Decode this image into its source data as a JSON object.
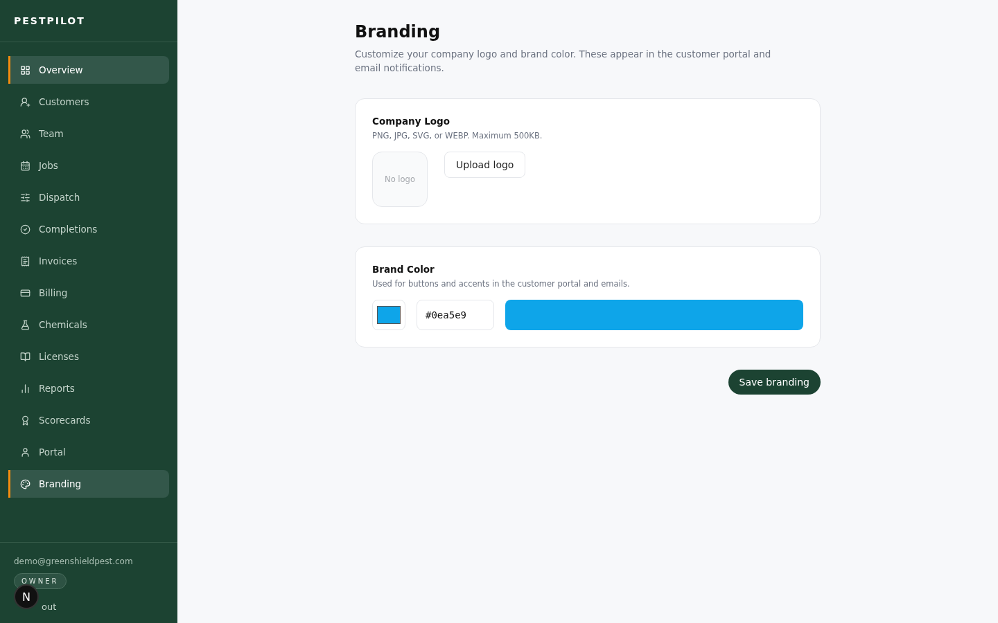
{
  "sidebar": {
    "brand": "PESTPILOT",
    "items": [
      {
        "label": "Overview",
        "selected": true
      },
      {
        "label": "Customers",
        "selected": false
      },
      {
        "label": "Team",
        "selected": false
      },
      {
        "label": "Jobs",
        "selected": false
      },
      {
        "label": "Dispatch",
        "selected": false
      },
      {
        "label": "Completions",
        "selected": false
      },
      {
        "label": "Invoices",
        "selected": false
      },
      {
        "label": "Billing",
        "selected": false
      },
      {
        "label": "Chemicals",
        "selected": false
      },
      {
        "label": "Licenses",
        "selected": false
      },
      {
        "label": "Reports",
        "selected": false
      },
      {
        "label": "Scorecards",
        "selected": false
      },
      {
        "label": "Portal",
        "selected": false
      },
      {
        "label": "Branding",
        "selected": true
      }
    ],
    "email": "demo@greenshieldpest.com",
    "role": "OWNER",
    "sign_out": "out",
    "dev_badge": "N"
  },
  "page": {
    "title": "Branding",
    "description": "Customize your company logo and brand color. These appear in the customer portal and email notifications."
  },
  "logo_card": {
    "title": "Company Logo",
    "hint": "PNG, JPG, SVG, or WEBP. Maximum 500KB.",
    "placeholder": "No logo",
    "button": "Upload logo"
  },
  "color_card": {
    "title": "Brand Color",
    "hint": "Used for buttons and accents in the customer portal and emails.",
    "value": "#0ea5e9"
  },
  "save_button": "Save branding"
}
